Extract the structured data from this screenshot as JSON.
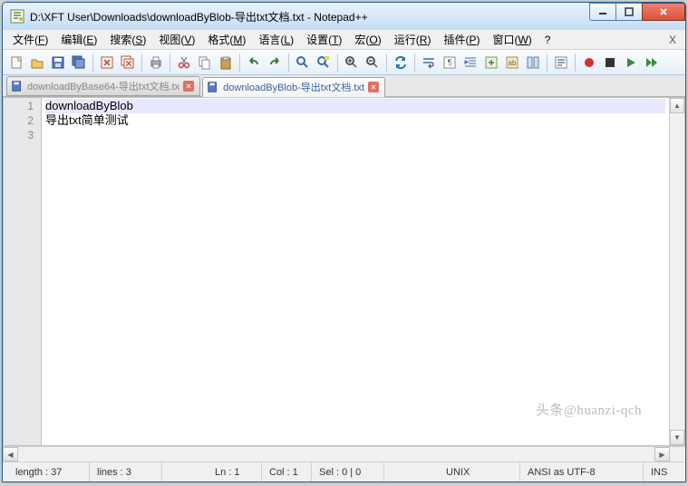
{
  "title": "D:\\XFT User\\Downloads\\downloadByBlob-导出txt文档.txt - Notepad++",
  "menus": [
    {
      "label": "文件",
      "u": "F"
    },
    {
      "label": "编辑",
      "u": "E"
    },
    {
      "label": "搜索",
      "u": "S"
    },
    {
      "label": "视图",
      "u": "V"
    },
    {
      "label": "格式",
      "u": "M"
    },
    {
      "label": "语言",
      "u": "L"
    },
    {
      "label": "设置",
      "u": "T"
    },
    {
      "label": "宏",
      "u": "O"
    },
    {
      "label": "运行",
      "u": "R"
    },
    {
      "label": "插件",
      "u": "P"
    },
    {
      "label": "窗口",
      "u": "W"
    },
    {
      "label": "?",
      "u": ""
    }
  ],
  "menu_close": "X",
  "toolbar_icons": [
    "new",
    "open",
    "save",
    "saveall",
    "|",
    "closefile",
    "closeall",
    "|",
    "print",
    "|",
    "cut",
    "copy",
    "paste",
    "|",
    "undo",
    "redo",
    "|",
    "find",
    "replace",
    "|",
    "zoomin",
    "zoomout",
    "|",
    "sync",
    "|",
    "wordwrap",
    "showall",
    "indent",
    "foldlevel",
    "userlang",
    "docmap",
    "|",
    "funclist",
    "|",
    "record",
    "stop",
    "play",
    "playfast"
  ],
  "tabs": [
    {
      "name": "downloadByBase64-导出txt文档.tx",
      "active": false
    },
    {
      "name": "downloadByBlob-导出txt文档.txt",
      "active": true
    }
  ],
  "gutter": [
    "1",
    "2",
    "3"
  ],
  "lines": [
    "downloadByBlob",
    "导出txt简单测试",
    ""
  ],
  "status": {
    "length": "length : 37",
    "lines": "lines : 3",
    "ln": "Ln : 1",
    "col": "Col : 1",
    "sel": "Sel : 0 | 0",
    "eol": "UNIX",
    "enc": "ANSI as UTF-8",
    "ins": "INS"
  },
  "watermark": "头条@huanzi-qch"
}
